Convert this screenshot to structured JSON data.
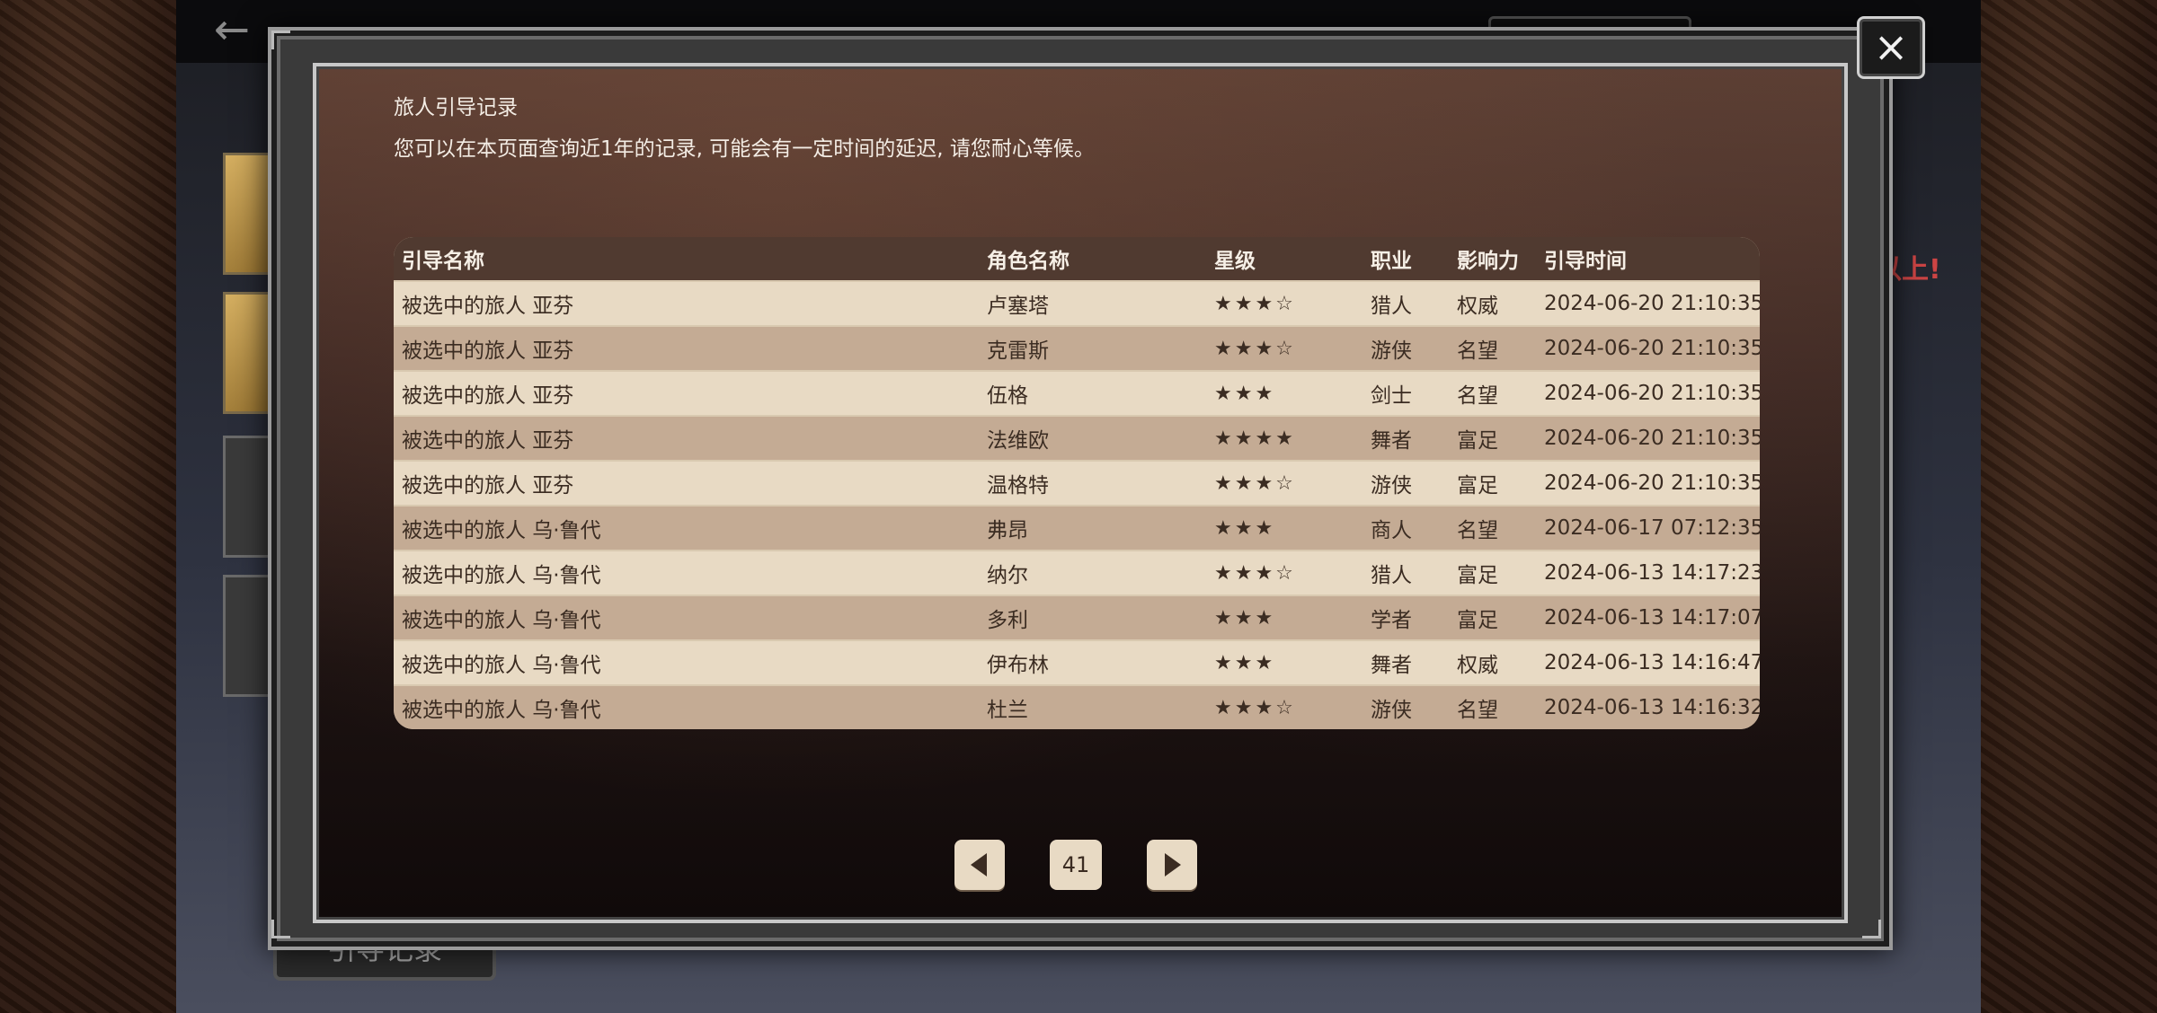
{
  "dialog": {
    "title": "旅人引导记录",
    "subtitle": "您可以在本页面查询近1年的记录, 可能会有一定时间的延迟, 请您耐心等候。",
    "close_icon": "×"
  },
  "table": {
    "headers": {
      "name": "引导名称",
      "character": "角色名称",
      "stars": "星级",
      "job": "职业",
      "influence": "影响力",
      "time": "引导时间"
    },
    "rows": [
      {
        "name": "被选中的旅人 亚芬",
        "character": "卢塞塔",
        "stars": "★★★☆",
        "job": "猎人",
        "influence": "权威",
        "time": "2024-06-20 21:10:35"
      },
      {
        "name": "被选中的旅人 亚芬",
        "character": "克雷斯",
        "stars": "★★★☆",
        "job": "游侠",
        "influence": "名望",
        "time": "2024-06-20 21:10:35"
      },
      {
        "name": "被选中的旅人 亚芬",
        "character": "伍格",
        "stars": "★★★",
        "job": "剑士",
        "influence": "名望",
        "time": "2024-06-20 21:10:35"
      },
      {
        "name": "被选中的旅人 亚芬",
        "character": "法维欧",
        "stars": "★★★★",
        "job": "舞者",
        "influence": "富足",
        "time": "2024-06-20 21:10:35"
      },
      {
        "name": "被选中的旅人 亚芬",
        "character": "温格特",
        "stars": "★★★☆",
        "job": "游侠",
        "influence": "富足",
        "time": "2024-06-20 21:10:35"
      },
      {
        "name": "被选中的旅人 乌·鲁代",
        "character": "弗昂",
        "stars": "★★★",
        "job": "商人",
        "influence": "名望",
        "time": "2024-06-17 07:12:35"
      },
      {
        "name": "被选中的旅人 乌·鲁代",
        "character": "纳尔",
        "stars": "★★★☆",
        "job": "猎人",
        "influence": "富足",
        "time": "2024-06-13 14:17:23"
      },
      {
        "name": "被选中的旅人 乌·鲁代",
        "character": "多利",
        "stars": "★★★",
        "job": "学者",
        "influence": "富足",
        "time": "2024-06-13 14:17:07"
      },
      {
        "name": "被选中的旅人 乌·鲁代",
        "character": "伊布林",
        "stars": "★★★",
        "job": "舞者",
        "influence": "权威",
        "time": "2024-06-13 14:16:47"
      },
      {
        "name": "被选中的旅人 乌·鲁代",
        "character": "杜兰",
        "stars": "★★★☆",
        "job": "游侠",
        "influence": "名望",
        "time": "2024-06-13 14:16:32"
      }
    ]
  },
  "pager": {
    "current_page": "41",
    "prev_icon": "triangle-left-icon",
    "next_icon": "triangle-right-icon"
  },
  "background": {
    "back_icon": "←",
    "bottom_button": "引导记录",
    "hint_text": "以上!",
    "hint_color": "#cc4444"
  }
}
